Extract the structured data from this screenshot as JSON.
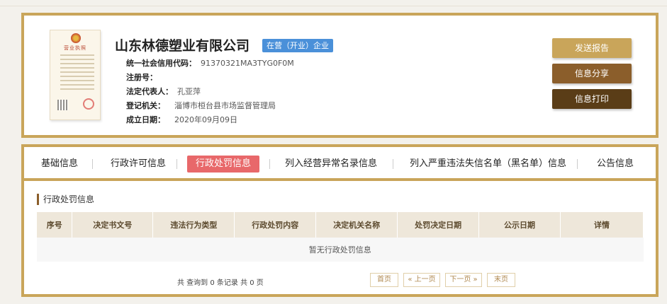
{
  "company": {
    "name": "山东林德塑业有限公司",
    "status": "在营（开业）企业",
    "license_title": "营业执照",
    "fields": [
      {
        "label": "统一社会信用代码：",
        "value": "91370321MA3TYG0F0M"
      },
      {
        "label": "注册号：",
        "value": ""
      },
      {
        "label": "法定代表人：",
        "value": "孔亚萍"
      },
      {
        "label": "登记机关：",
        "value": "淄博市桓台县市场监督管理局"
      },
      {
        "label": "成立日期：",
        "value": "2020年09月09日"
      }
    ]
  },
  "actions": {
    "report": "发送报告",
    "share": "信息分享",
    "print": "信息打印"
  },
  "tabs": [
    {
      "label": "基础信息"
    },
    {
      "label": "行政许可信息"
    },
    {
      "label": "行政处罚信息"
    },
    {
      "label": "列入经营异常名录信息"
    },
    {
      "label": "列入严重违法失信名单（黑名单）信息"
    },
    {
      "label": "公告信息"
    }
  ],
  "section": {
    "title": "行政处罚信息",
    "columns": [
      "序号",
      "决定书文号",
      "违法行为类型",
      "行政处罚内容",
      "决定机关名称",
      "处罚决定日期",
      "公示日期",
      "详情"
    ],
    "empty_text": "暂无行政处罚信息"
  },
  "pager": {
    "total_text": "共 查询到 0 条记录 共 0 页",
    "first": "首页",
    "prev": "« 上一页",
    "next": "下一页 »",
    "last": "末页"
  },
  "colors": {
    "accent_gold": "#c9a55a",
    "active_tab": "#e8686a",
    "badge_blue": "#4a90d9"
  }
}
